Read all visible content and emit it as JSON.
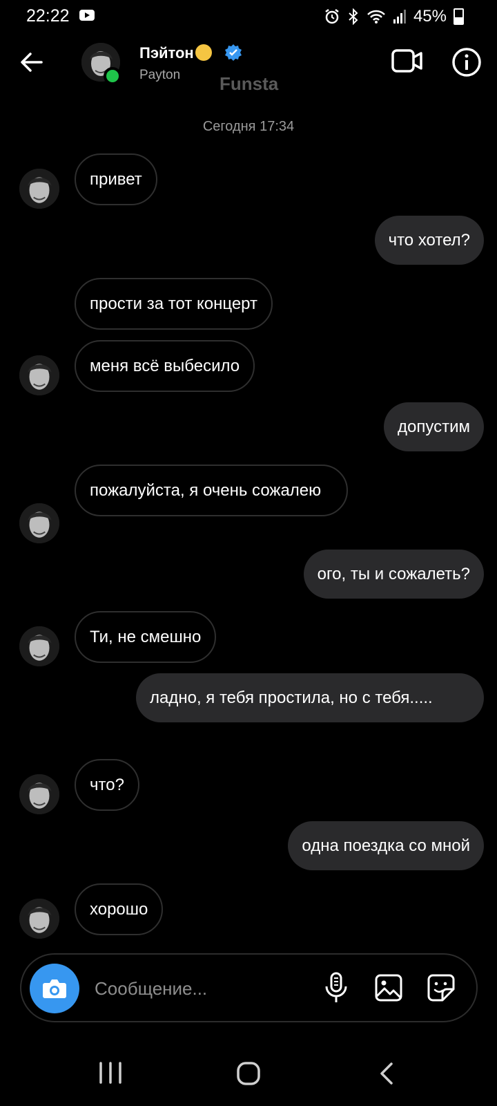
{
  "status_bar": {
    "time": "22:22",
    "battery": "45%"
  },
  "header": {
    "name": "Пэйтон",
    "username": "Payton",
    "watermark": "Funsta"
  },
  "timestamp": "Сегодня 17:34",
  "messages": [
    {
      "side": "in",
      "text": "привет",
      "avatar": true
    },
    {
      "side": "out",
      "text": "что хотел?"
    },
    {
      "side": "in",
      "text": "прости за тот концерт",
      "avatar": false
    },
    {
      "side": "in",
      "text": "меня всё выбесило",
      "avatar": true
    },
    {
      "side": "out",
      "text": "допустим"
    },
    {
      "side": "in",
      "text": "пожалуйста, я очень сожалею",
      "avatar": true
    },
    {
      "side": "out",
      "text": "ого, ты и сожалеть?"
    },
    {
      "side": "in",
      "text": "Ти, не смешно",
      "avatar": true
    },
    {
      "side": "out",
      "text": "ладно, я тебя простила, но с тебя....."
    },
    {
      "side": "in",
      "text": "что?",
      "avatar": true
    },
    {
      "side": "out",
      "text": "одна поездка со мной"
    },
    {
      "side": "in",
      "text": "хорошо",
      "avatar": true
    }
  ],
  "composer": {
    "placeholder": "Сообщение..."
  },
  "colors": {
    "accent": "#3797f0",
    "online": "#1fc44a",
    "outgoing_bubble": "#2a2a2c",
    "background": "#000000"
  }
}
